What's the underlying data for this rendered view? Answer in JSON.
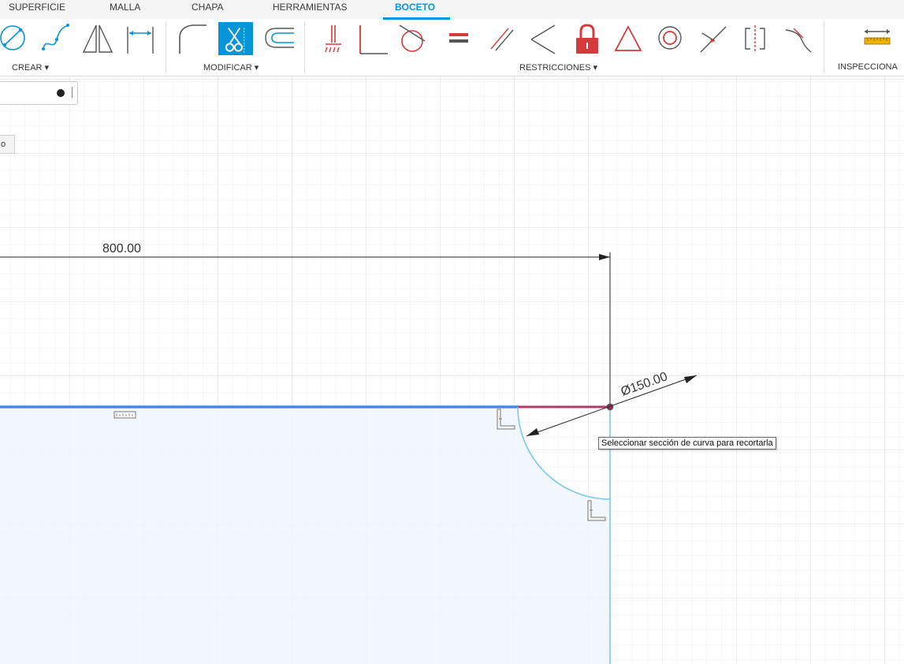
{
  "tabs": [
    {
      "label": "SUPERFICIE",
      "active": false
    },
    {
      "label": "MALLA",
      "active": false
    },
    {
      "label": "CHAPA",
      "active": false
    },
    {
      "label": "HERRAMIENTAS",
      "active": false
    },
    {
      "label": "BOCETO",
      "active": true
    }
  ],
  "groups": {
    "crear": "CREAR ▾",
    "modificar": "MODIFICAR ▾",
    "restricciones": "RESTRICCIONES ▾",
    "inspeccionar": "INSPECCIONA"
  },
  "left_tab_label": "o",
  "sketch": {
    "linear_dimension": "800.00",
    "diameter_dimension": "Ø150.00"
  },
  "tooltip": "Seleccionar sección de curva para recortarla",
  "colors": {
    "accent": "#0696d7",
    "constraint_red": "#d63b3b",
    "profile_fill": "#eef6fc",
    "selected_line": "#4a86e8",
    "highlight_segment": "#b03a6a",
    "curve": "#7ec8e3"
  }
}
